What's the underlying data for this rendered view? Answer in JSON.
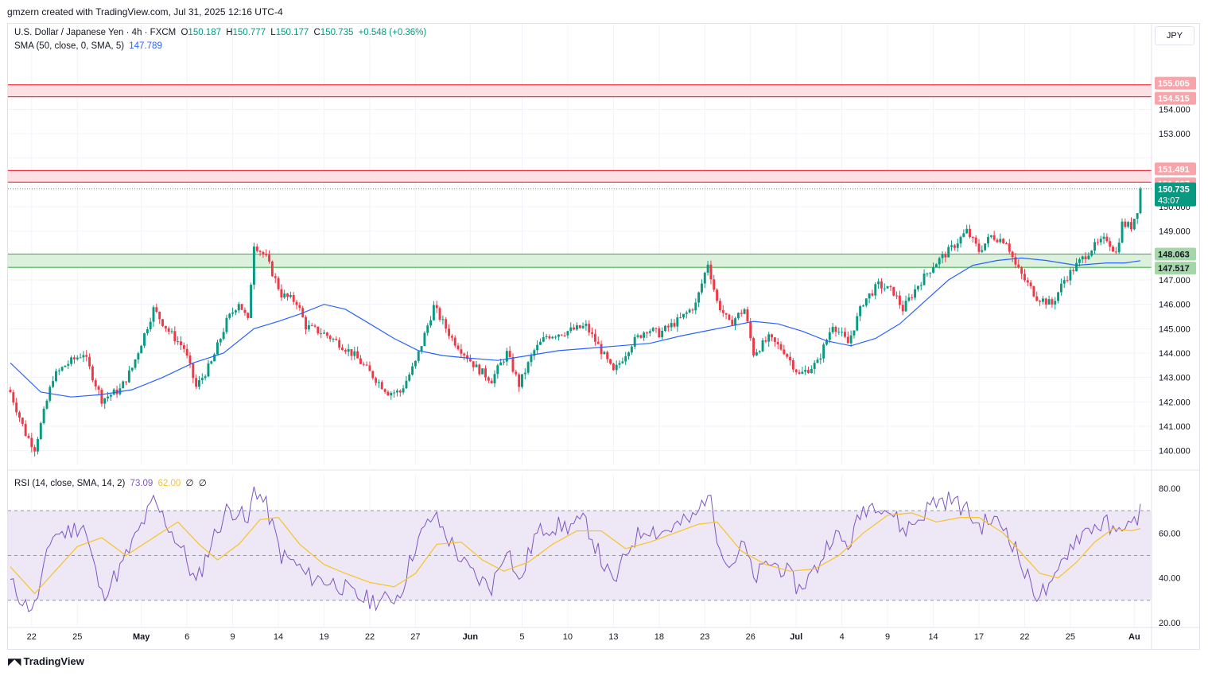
{
  "header": {
    "credit": "gmzern created with TradingView.com, Jul 31, 2025 12:16 UTC-4"
  },
  "legend": {
    "symbol": "U.S. Dollar / Japanese Yen · 4h · FXCM",
    "open_label": "O",
    "open": "150.187",
    "high_label": "H",
    "high": "150.777",
    "low_label": "L",
    "low": "150.177",
    "close_label": "C",
    "close": "150.735",
    "change": "+0.548 (+0.36%)",
    "sma_label": "SMA (50, close, 0, SMA, 5)",
    "sma_value": "147.789",
    "rsi_label": "RSI (14, close, SMA, 14, 2)",
    "rsi_value": "73.09",
    "rsi_ma_value": "62.00",
    "rsi_extra_1": "∅",
    "rsi_extra_2": "∅"
  },
  "currency": "JPY",
  "footer": {
    "brand": "TradingView",
    "logo_icon": "tradingview-logo-icon"
  },
  "colors": {
    "up": "#089981",
    "down": "#f23645",
    "sma": "#2962ff",
    "rsi": "#7e57c2",
    "rsi_ma": "#f7c325",
    "resistance_fill": "#fddde0",
    "resistance_line": "#f23645",
    "support_fill": "#d8f0d8",
    "support_line": "#4caf50",
    "rsi_band": "#ede7f6"
  },
  "chart_data": [
    {
      "type": "candlestick",
      "title": "U.S. Dollar / Japanese Yen · 4h · FXCM",
      "ylim": [
        139.4,
        156.2
      ],
      "y_ticks": [
        140,
        141,
        142,
        143,
        144,
        145,
        146,
        147,
        148,
        149,
        150,
        151,
        152,
        153,
        154,
        155
      ],
      "y_tick_labels": [
        "140.000",
        "141.000",
        "142.000",
        "143.000",
        "144.000",
        "145.000",
        "146.000",
        "147.000",
        "148.000",
        "149.000",
        "150.000",
        "",
        "",
        "153.000",
        "154.000",
        ""
      ],
      "x_labels": [
        {
          "label": "22",
          "idx": 7
        },
        {
          "label": "25",
          "idx": 22
        },
        {
          "label": "May",
          "idx": 43
        },
        {
          "label": "6",
          "idx": 58
        },
        {
          "label": "9",
          "idx": 73
        },
        {
          "label": "14",
          "idx": 88
        },
        {
          "label": "19",
          "idx": 103
        },
        {
          "label": "22",
          "idx": 118
        },
        {
          "label": "27",
          "idx": 133
        },
        {
          "label": "Jun",
          "idx": 151
        },
        {
          "label": "5",
          "idx": 168
        },
        {
          "label": "10",
          "idx": 183
        },
        {
          "label": "13",
          "idx": 198
        },
        {
          "label": "18",
          "idx": 213
        },
        {
          "label": "23",
          "idx": 228
        },
        {
          "label": "26",
          "idx": 243
        },
        {
          "label": "Jul",
          "idx": 258
        },
        {
          "label": "4",
          "idx": 273
        },
        {
          "label": "9",
          "idx": 288
        },
        {
          "label": "14",
          "idx": 303
        },
        {
          "label": "17",
          "idx": 318
        },
        {
          "label": "22",
          "idx": 333
        },
        {
          "label": "25",
          "idx": 348
        },
        {
          "label": "Au",
          "idx": 369
        }
      ],
      "close_path": [
        [
          0,
          142.4
        ],
        [
          5,
          140.7
        ],
        [
          8,
          140.1
        ],
        [
          14,
          143.0
        ],
        [
          18,
          143.5
        ],
        [
          24,
          144.0
        ],
        [
          30,
          142.1
        ],
        [
          36,
          142.5
        ],
        [
          40,
          143.4
        ],
        [
          47,
          145.8
        ],
        [
          52,
          144.9
        ],
        [
          57,
          144.2
        ],
        [
          61,
          142.6
        ],
        [
          66,
          143.6
        ],
        [
          71,
          145.3
        ],
        [
          75,
          146.1
        ],
        [
          78,
          145.3
        ],
        [
          80,
          148.5
        ],
        [
          84,
          147.9
        ],
        [
          89,
          146.4
        ],
        [
          94,
          146.1
        ],
        [
          97,
          145.1
        ],
        [
          103,
          144.8
        ],
        [
          108,
          144.4
        ],
        [
          113,
          143.9
        ],
        [
          118,
          143.2
        ],
        [
          124,
          142.4
        ],
        [
          128,
          142.4
        ],
        [
          133,
          143.6
        ],
        [
          139,
          145.9
        ],
        [
          145,
          144.6
        ],
        [
          149,
          144.0
        ],
        [
          153,
          143.4
        ],
        [
          158,
          142.9
        ],
        [
          163,
          144.0
        ],
        [
          167,
          142.7
        ],
        [
          172,
          144.1
        ],
        [
          176,
          144.7
        ],
        [
          183,
          144.9
        ],
        [
          189,
          145.1
        ],
        [
          194,
          144.1
        ],
        [
          198,
          143.2
        ],
        [
          204,
          144.4
        ],
        [
          209,
          145.0
        ],
        [
          213,
          144.8
        ],
        [
          220,
          145.4
        ],
        [
          225,
          146.0
        ],
        [
          229,
          147.7
        ],
        [
          232,
          146.1
        ],
        [
          236,
          145.2
        ],
        [
          241,
          145.8
        ],
        [
          244,
          144.0
        ],
        [
          249,
          144.6
        ],
        [
          254,
          144.1
        ],
        [
          259,
          143.1
        ],
        [
          265,
          143.6
        ],
        [
          270,
          145.2
        ],
        [
          275,
          144.4
        ],
        [
          280,
          146.1
        ],
        [
          285,
          146.8
        ],
        [
          290,
          146.5
        ],
        [
          293,
          145.8
        ],
        [
          298,
          146.8
        ],
        [
          303,
          147.6
        ],
        [
          309,
          148.3
        ],
        [
          314,
          149.0
        ],
        [
          318,
          148.2
        ],
        [
          322,
          148.8
        ],
        [
          327,
          148.6
        ],
        [
          330,
          147.6
        ],
        [
          333,
          147.0
        ],
        [
          337,
          146.3
        ],
        [
          342,
          146.0
        ],
        [
          346,
          147.0
        ],
        [
          350,
          147.6
        ],
        [
          355,
          148.3
        ],
        [
          360,
          148.7
        ],
        [
          363,
          148.1
        ],
        [
          365,
          149.3
        ],
        [
          368,
          149.2
        ],
        [
          370,
          149.9
        ],
        [
          371,
          150.735
        ]
      ],
      "sma": [
        [
          0,
          143.6
        ],
        [
          10,
          142.4
        ],
        [
          20,
          142.2
        ],
        [
          30,
          142.3
        ],
        [
          40,
          142.5
        ],
        [
          50,
          143.0
        ],
        [
          60,
          143.6
        ],
        [
          70,
          144.0
        ],
        [
          80,
          145.0
        ],
        [
          88,
          145.3
        ],
        [
          95,
          145.6
        ],
        [
          103,
          146.0
        ],
        [
          110,
          145.8
        ],
        [
          118,
          145.2
        ],
        [
          126,
          144.6
        ],
        [
          134,
          144.1
        ],
        [
          142,
          143.9
        ],
        [
          150,
          143.8
        ],
        [
          160,
          143.7
        ],
        [
          170,
          143.9
        ],
        [
          180,
          144.1
        ],
        [
          190,
          144.2
        ],
        [
          200,
          144.3
        ],
        [
          210,
          144.4
        ],
        [
          220,
          144.7
        ],
        [
          228,
          144.9
        ],
        [
          236,
          145.1
        ],
        [
          244,
          145.3
        ],
        [
          252,
          145.2
        ],
        [
          260,
          144.9
        ],
        [
          268,
          144.5
        ],
        [
          276,
          144.3
        ],
        [
          284,
          144.6
        ],
        [
          292,
          145.2
        ],
        [
          300,
          146.1
        ],
        [
          308,
          147.0
        ],
        [
          316,
          147.6
        ],
        [
          324,
          147.8
        ],
        [
          332,
          147.9
        ],
        [
          340,
          147.8
        ],
        [
          350,
          147.6
        ],
        [
          360,
          147.7
        ],
        [
          366,
          147.7
        ],
        [
          371,
          147.789
        ]
      ],
      "zones": [
        {
          "kind": "resistance",
          "from": 154.515,
          "to": 155.005,
          "label_top": "155.005",
          "label_bottom": "154.515"
        },
        {
          "kind": "resistance",
          "from": 151.007,
          "to": 151.491,
          "label_top": "151.491",
          "label_bottom": "151.007"
        },
        {
          "kind": "support",
          "from": 147.517,
          "to": 148.063,
          "label_top": "148.063",
          "label_bottom": "147.517"
        }
      ],
      "last_price": {
        "value": 150.735,
        "label": "150.735",
        "countdown": "43:07"
      }
    },
    {
      "type": "line",
      "title": "RSI (14, close, SMA, 14, 2)",
      "ylim": [
        20,
        80
      ],
      "y_ticks": [
        20,
        40,
        60,
        80
      ],
      "y_tick_labels": [
        "20.00",
        "40.00",
        "60.00",
        "80.00"
      ],
      "band": [
        30,
        70
      ],
      "midline": 50,
      "series": [
        {
          "name": "RSI",
          "key": "rsi",
          "values": [
            [
              0,
              38
            ],
            [
              5,
              28
            ],
            [
              8,
              27
            ],
            [
              14,
              60
            ],
            [
              18,
              60
            ],
            [
              24,
              64
            ],
            [
              30,
              32
            ],
            [
              36,
              44
            ],
            [
              40,
              55
            ],
            [
              47,
              74
            ],
            [
              52,
              63
            ],
            [
              57,
              51
            ],
            [
              61,
              37
            ],
            [
              66,
              56
            ],
            [
              71,
              70
            ],
            [
              75,
              70
            ],
            [
              78,
              63
            ],
            [
              80,
              81
            ],
            [
              84,
              72
            ],
            [
              89,
              50
            ],
            [
              94,
              46
            ],
            [
              97,
              41
            ],
            [
              103,
              39
            ],
            [
              108,
              37
            ],
            [
              113,
              32
            ],
            [
              118,
              30
            ],
            [
              124,
              30
            ],
            [
              128,
              33
            ],
            [
              133,
              55
            ],
            [
              139,
              68
            ],
            [
              145,
              55
            ],
            [
              149,
              46
            ],
            [
              153,
              40
            ],
            [
              158,
              36
            ],
            [
              163,
              55
            ],
            [
              167,
              37
            ],
            [
              172,
              58
            ],
            [
              176,
              63
            ],
            [
              183,
              63
            ],
            [
              189,
              65
            ],
            [
              194,
              48
            ],
            [
              198,
              37
            ],
            [
              204,
              56
            ],
            [
              209,
              63
            ],
            [
              213,
              60
            ],
            [
              220,
              64
            ],
            [
              225,
              67
            ],
            [
              229,
              79
            ],
            [
              232,
              60
            ],
            [
              236,
              45
            ],
            [
              241,
              55
            ],
            [
              244,
              39
            ],
            [
              249,
              47
            ],
            [
              254,
              44
            ],
            [
              259,
              35
            ],
            [
              265,
              45
            ],
            [
              270,
              60
            ],
            [
              275,
              54
            ],
            [
              280,
              71
            ],
            [
              285,
              74
            ],
            [
              290,
              68
            ],
            [
              293,
              61
            ],
            [
              298,
              66
            ],
            [
              303,
              74
            ],
            [
              309,
              75
            ],
            [
              314,
              70
            ],
            [
              318,
              63
            ],
            [
              322,
              66
            ],
            [
              327,
              62
            ],
            [
              330,
              53
            ],
            [
              333,
              42
            ],
            [
              337,
              33
            ],
            [
              342,
              35
            ],
            [
              346,
              50
            ],
            [
              350,
              58
            ],
            [
              355,
              63
            ],
            [
              360,
              64
            ],
            [
              363,
              58
            ],
            [
              365,
              65
            ],
            [
              368,
              62
            ],
            [
              370,
              67
            ],
            [
              371,
              73.09
            ]
          ]
        },
        {
          "name": "RSI SMA",
          "key": "rsi_ma",
          "values": [
            [
              0,
              45
            ],
            [
              8,
              33
            ],
            [
              14,
              42
            ],
            [
              22,
              54
            ],
            [
              30,
              58
            ],
            [
              38,
              50
            ],
            [
              47,
              58
            ],
            [
              55,
              65
            ],
            [
              62,
              55
            ],
            [
              68,
              48
            ],
            [
              75,
              55
            ],
            [
              82,
              66
            ],
            [
              88,
              67
            ],
            [
              95,
              55
            ],
            [
              103,
              46
            ],
            [
              110,
              42
            ],
            [
              118,
              38
            ],
            [
              126,
              36
            ],
            [
              133,
              42
            ],
            [
              140,
              55
            ],
            [
              148,
              56
            ],
            [
              155,
              48
            ],
            [
              162,
              43
            ],
            [
              170,
              47
            ],
            [
              178,
              55
            ],
            [
              186,
              61
            ],
            [
              194,
              61
            ],
            [
              202,
              53
            ],
            [
              210,
              56
            ],
            [
              218,
              60
            ],
            [
              226,
              64
            ],
            [
              232,
              65
            ],
            [
              240,
              52
            ],
            [
              248,
              46
            ],
            [
              256,
              43
            ],
            [
              264,
              44
            ],
            [
              272,
              50
            ],
            [
              280,
              60
            ],
            [
              288,
              68
            ],
            [
              296,
              69
            ],
            [
              304,
              65
            ],
            [
              312,
              67
            ],
            [
              318,
              67
            ],
            [
              326,
              60
            ],
            [
              332,
              51
            ],
            [
              338,
              42
            ],
            [
              344,
              40
            ],
            [
              350,
              47
            ],
            [
              356,
              56
            ],
            [
              362,
              62
            ],
            [
              368,
              61
            ],
            [
              371,
              62
            ]
          ]
        }
      ],
      "x_labels_shared": true
    }
  ]
}
